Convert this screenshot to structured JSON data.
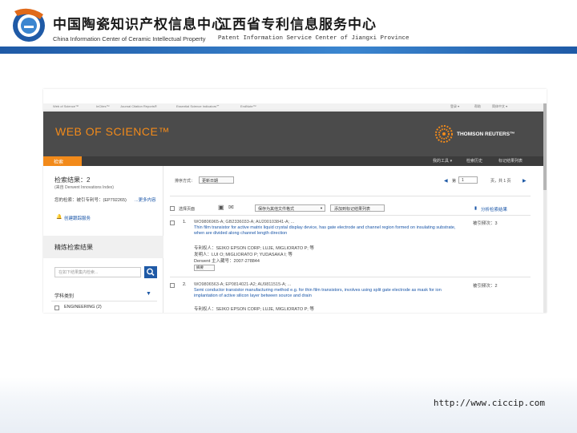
{
  "slide": {
    "org_cn_1": "中国陶瓷知识产权信息中心",
    "org_cn_2": "江西省专利信息服务中心",
    "org_en_1": "China Information Center of Ceramic Intellectual Property",
    "org_en_2": "Patent Information Service Center of  Jiangxi  Province",
    "footer_url": "http://www.ciccip.com"
  },
  "wos": {
    "topnav": [
      "Web of Science™",
      "InCites™",
      "Journal Citation Reports®",
      "Essential Science Indicators℠",
      "EndNote™"
    ],
    "topnav_right": [
      "登录 ▾",
      "帮助",
      "简体中文 ▾"
    ],
    "title": "WEB OF SCIENCE™",
    "publisher": "THOMSON REUTERS™",
    "search_tab": "检索",
    "nav_right": [
      "我的工具 ▾",
      "检索历史",
      "标记结果列表"
    ],
    "results_label": "检索结果：2",
    "database": "(来自 Derwent Innovations Index)",
    "query_label": "您的检索：被引专利号：(EP792265)",
    "query_more": "...更多内容",
    "alert": "创建跟踪服务",
    "refine_heading": "精炼检索结果",
    "refine_placeholder": "在如下结果集内检索...",
    "category_heading": "学科类别",
    "category_item": "ENGINEERING (2)",
    "sort_label": "排序方式：",
    "sort_value": "更新日期",
    "page_label": "第",
    "page_value": "1",
    "page_total": "页，共 1 页",
    "select_page": "选择页面",
    "save_format": "保存为其他文件格式",
    "add_marked": "添加到标记结果列表",
    "analyze": "分析检索结果",
    "results": [
      {
        "index": "1.",
        "numbers": "WO9806965-A; GB2336033-A; AU200103841-A; ...",
        "title": "Thin film transistor for active matrix liquid crystal display device, has gate electrode and channel region formed on insulating substrate, when are divided along channel length direction",
        "assignee": "专利权人：SEIKO EPSON CORP; LUJE, MIGLIORATO P; 等",
        "inventor": "发明人：LUI O; MIGLIORATO P; YUDASAKA I; 等",
        "derwent": "Derwent 主入藏号：2007-278844",
        "cited": "被引频次：3",
        "more": "摘要"
      },
      {
        "index": "2.",
        "numbers": "WO9806563-A; EP0814021-A2; AU9811515-A; ...",
        "title": "Semi conductor transistor manufacturing method e.g. for thin film transistors, involves using split gate electrode as mask for ion implantation of active silicon layer between source and drain",
        "assignee": "专利权人：SEIKO EPSON CORP; LUJE, MIGLIORATO P; 等",
        "inventor": "",
        "derwent": "",
        "cited": "被引频次：2",
        "more": ""
      }
    ]
  },
  "colors": {
    "accent_orange": "#f28a1a",
    "banner_gray": "#4b4b4b",
    "header_blue": "#1f5aa6",
    "link_blue": "#1a56a8"
  }
}
